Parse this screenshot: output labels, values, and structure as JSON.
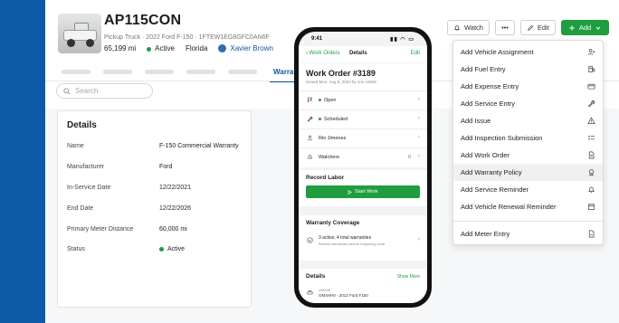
{
  "vehicle": {
    "name": "AP115CON",
    "subtitle": "Pickup Truck · 2022 Ford F-150 · 1FTEW1EG8GFC0AN6F",
    "meter": "65,199 mi",
    "status": "Active",
    "location": "Florida",
    "owner": "Xavier Brown"
  },
  "tabs": {
    "active_label": "Warranties"
  },
  "search": {
    "placeholder": "Search"
  },
  "details": {
    "heading": "Details",
    "rows": [
      {
        "label": "Name",
        "value": "F-150 Commercial Warranty"
      },
      {
        "label": "Manufacturer",
        "value": "Ford"
      },
      {
        "label": "In-Service Date",
        "value": "12/22/2021"
      },
      {
        "label": "End Date",
        "value": "12/22/2026"
      },
      {
        "label": "Primary Meter Distance",
        "value": "60,000 mi"
      },
      {
        "label": "Status",
        "value": "Active"
      }
    ]
  },
  "actions": {
    "watch": "Watch",
    "more": "•••",
    "edit": "Edit",
    "add": "Add"
  },
  "dropdown": {
    "items": [
      {
        "label": "Add Vehicle Assignment",
        "icon": "person-add-icon"
      },
      {
        "label": "Add Fuel Entry",
        "icon": "fuel-pump-icon"
      },
      {
        "label": "Add Expense Entry",
        "icon": "credit-card-icon"
      },
      {
        "label": "Add Service Entry",
        "icon": "wrench-icon"
      },
      {
        "label": "Add Issue",
        "icon": "warning-triangle-icon"
      },
      {
        "label": "Add Inspection Submission",
        "icon": "checklist-icon"
      },
      {
        "label": "Add Work Order",
        "icon": "document-icon"
      },
      {
        "label": "Add Warranty Policy",
        "icon": "ribbon-icon"
      },
      {
        "label": "Add Service Reminder",
        "icon": "bell-icon"
      },
      {
        "label": "Add Vehicle Renewal Reminder",
        "icon": "calendar-icon"
      },
      {
        "label": "Add Meter Entry",
        "icon": "gauge-icon"
      }
    ],
    "highlighted_index": 7
  },
  "phone": {
    "time": "9:41",
    "back": "Work Orders",
    "nav_title": "Details",
    "edit": "Edit",
    "wo_title": "Work Order #3189",
    "wo_issued": "Issued Mon, Aug 9, 2023 by Jon Hinkle",
    "rows": [
      {
        "text": "Open",
        "icon": "flag-icon"
      },
      {
        "text": "Scheduled",
        "icon": "wrench-icon"
      },
      {
        "text": "Rio Jimenez",
        "icon": "person-icon"
      },
      {
        "text": "Watchers",
        "icon": "bell-icon",
        "count": "0"
      }
    ],
    "record_labor": "Record Labor",
    "start_work": "Start Work",
    "warranty_heading": "Warranty Coverage",
    "warranty_line1": "3 active, 4 total warranties",
    "warranty_line2": "Review warranties before beginning work.",
    "details_heading": "Details",
    "show_more": "Show More",
    "vehicle_label": "Vehicle",
    "vehicle_value": "OM4HH0 - 2012 Ford F150"
  },
  "colors": {
    "brand_blue": "#0c5aa6",
    "accent_green": "#1f9d3f",
    "status_green": "#1d9b4a"
  }
}
